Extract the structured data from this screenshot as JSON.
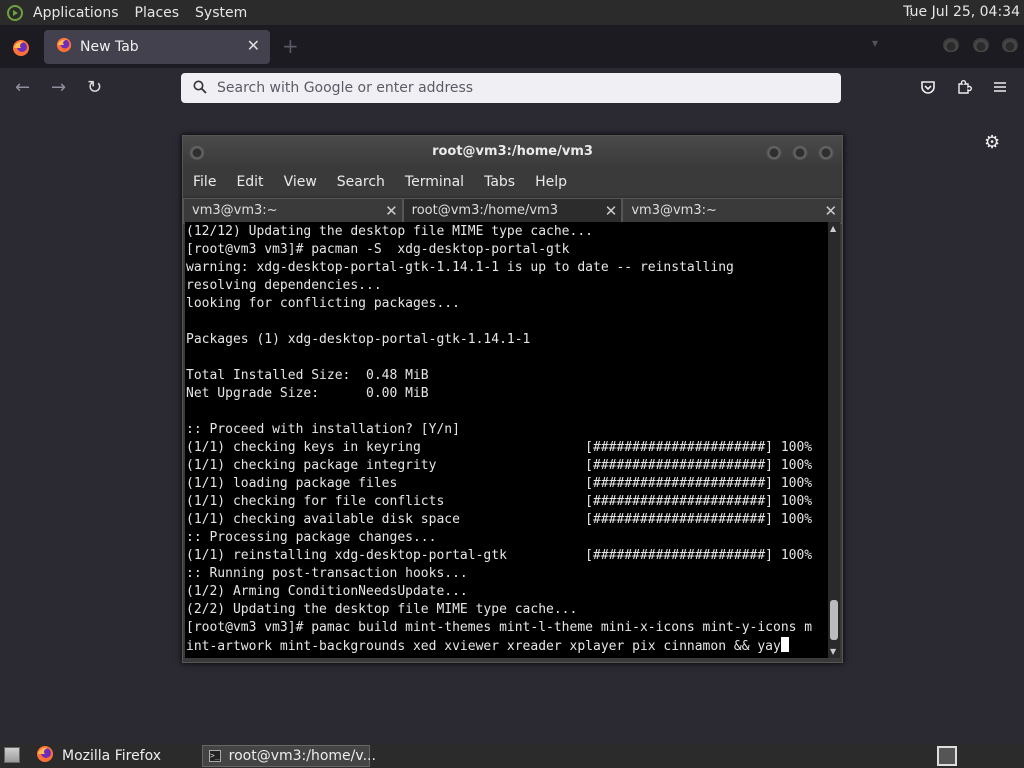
{
  "top_panel": {
    "menus": [
      "Applications",
      "Places",
      "System"
    ],
    "clock": "Tue Jul 25, 04:34"
  },
  "browser": {
    "tab": {
      "label": "New Tab",
      "close": "✕"
    },
    "new_tab": "+",
    "url_bar": {
      "placeholder": "Search with Google or enter address",
      "value": ""
    }
  },
  "terminal": {
    "title": "root@vm3:/home/vm3",
    "menu": [
      "File",
      "Edit",
      "View",
      "Search",
      "Terminal",
      "Tabs",
      "Help"
    ],
    "tabs": [
      {
        "label": "vm3@vm3:~",
        "active": false
      },
      {
        "label": "root@vm3:/home/vm3",
        "active": true
      },
      {
        "label": "vm3@vm3:~",
        "active": false
      }
    ],
    "tab_close": "✕",
    "output": "(12/12) Updating the desktop file MIME type cache...\n[root@vm3 vm3]# pacman -S  xdg-desktop-portal-gtk\nwarning: xdg-desktop-portal-gtk-1.14.1-1 is up to date -- reinstalling\nresolving dependencies...\nlooking for conflicting packages...\n\nPackages (1) xdg-desktop-portal-gtk-1.14.1-1\n\nTotal Installed Size:  0.48 MiB\nNet Upgrade Size:      0.00 MiB\n\n:: Proceed with installation? [Y/n]\n(1/1) checking keys in keyring                     [######################] 100%\n(1/1) checking package integrity                   [######################] 100%\n(1/1) loading package files                        [######################] 100%\n(1/1) checking for file conflicts                  [######################] 100%\n(1/1) checking available disk space                [######################] 100%\n:: Processing package changes...\n(1/1) reinstalling xdg-desktop-portal-gtk          [######################] 100%\n:: Running post-transaction hooks...\n(1/2) Arming ConditionNeedsUpdate...\n(2/2) Updating the desktop file MIME type cache...\n[root@vm3 vm3]# pamac build mint-themes mint-l-theme mini-x-icons mint-y-icons m\nint-artwork mint-backgrounds xed xviewer xreader xplayer pix cinnamon && yay"
  },
  "taskbar": {
    "items": [
      {
        "label": "Mozilla Firefox"
      },
      {
        "label": "root@vm3:/home/v..."
      }
    ]
  },
  "colors": {
    "terminal_bg": "#000000",
    "browser_bg": "#2b2a33",
    "accent_green": "#6fa13d"
  }
}
